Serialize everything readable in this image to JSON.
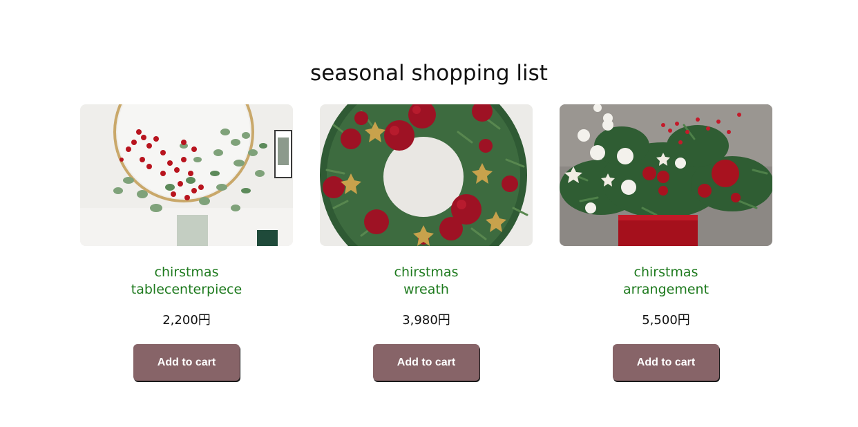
{
  "page": {
    "title": "seasonal shopping list"
  },
  "products": [
    {
      "name_line1": "chirstmas",
      "name_line2": "tablecenterpiece",
      "price": "2,200円",
      "button_label": "Add to cart",
      "image": "christmas-table-centerpiece-photo"
    },
    {
      "name_line1": "chirstmas",
      "name_line2": "wreath",
      "price": "3,980円",
      "button_label": "Add to cart",
      "image": "christmas-wreath-photo"
    },
    {
      "name_line1": "chirstmas",
      "name_line2": "arrangement",
      "price": "5,500円",
      "button_label": "Add to cart",
      "image": "christmas-arrangement-photo"
    }
  ],
  "colors": {
    "product_name": "#1e7a1e",
    "button_background": "#876468",
    "button_text": "#ffffff"
  }
}
